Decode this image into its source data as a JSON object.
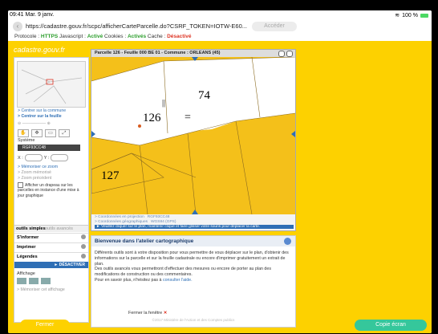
{
  "status": {
    "time": "09:41",
    "date": "Mar. 9 janv.",
    "battery": "100 %"
  },
  "browser": {
    "url": "https://cadastre.gouv.fr/scpc/afficherCarteParcelle.do?CSRF_TOKEN=IOTW-E60...",
    "access_label": "Accéder",
    "protocol_label": "Protocole :",
    "protocol_value": "HTTPS",
    "javascript_label": "Javascript :",
    "javascript_value": "Activé",
    "cookies_label": "Cookies :",
    "cookies_value": "Activés",
    "cache_label": "Cache :",
    "cache_value": "Désactivé"
  },
  "site": {
    "logo": "cadastre.gouv.fr"
  },
  "leftpanel": {
    "link_commune": "> Centrer sur la commune",
    "link_feuille": "> Centrer sur la feuille",
    "systeme_label": "Système",
    "systeme_value": "RGF93CC48",
    "x_label": "X :",
    "y_label": "Y :",
    "memoriser_zoom": "> Mémoriser ce zoom",
    "zoom_memorise": "> Zoom mémorisé",
    "zoom_precedent": "> Zoom précédent",
    "drapeau": "Afficher un drapeau sur les parcelles en instance d'une mise à jour graphique"
  },
  "tools_panel": {
    "tab_simples": "outils simples",
    "tab_avances": "outils avancés",
    "items": [
      "S'informer",
      "Imprimer",
      "Légendes"
    ],
    "desactiver": "DÉSACTIVER",
    "affichage": "Affichage",
    "memoriser_affichage": "> Mémoriser cet affichage"
  },
  "map": {
    "title": "Parcelle 126 - Feuille 000 BE 01 - Commune : ORLEANS (45)",
    "parcels": [
      "74",
      "126",
      "127"
    ],
    "coord_proj_label": "> Coordonnées en projection",
    "coord_proj_value": "RGF93CC48",
    "coord_geo_label": "> Coordonnées géographiques",
    "coord_geo_value": "WGS84 (GPS)",
    "hint": "► Veuillez cliquer sur le plan, maintenir cliqué et faire glisser votre souris pour déplacer la carte."
  },
  "info": {
    "title": "Bienvenue dans l'atelier cartographique",
    "p1": "Différents outils sont à votre disposition pour vous permettre de vous déplacer sur le plan, d'obtenir des informations sur la parcelle et sur la feuille cadastrale ou encore d'imprimer gratuitement un extrait de plan.",
    "p2": "Des outils avancés vous permettront d'effectuer des mesures ou encore de porter au plan des modifications de construction ou des commentaires.",
    "p3_prefix": "Pour en savoir plus, n'hésitez pas à ",
    "p3_link": "consulter l'aide.",
    "ministry": "©2017 Ministère de l'Action et des Comptes publics"
  },
  "close_window": "Fermer la fenêtre",
  "bottom": {
    "fermer": "Fermer",
    "copie": "Copie écran"
  },
  "colors": {
    "page_bg": "#fdd100",
    "parcel_fill": "#f4c01a",
    "link": "#2f6fb5",
    "copy_button": "#35c79b"
  }
}
